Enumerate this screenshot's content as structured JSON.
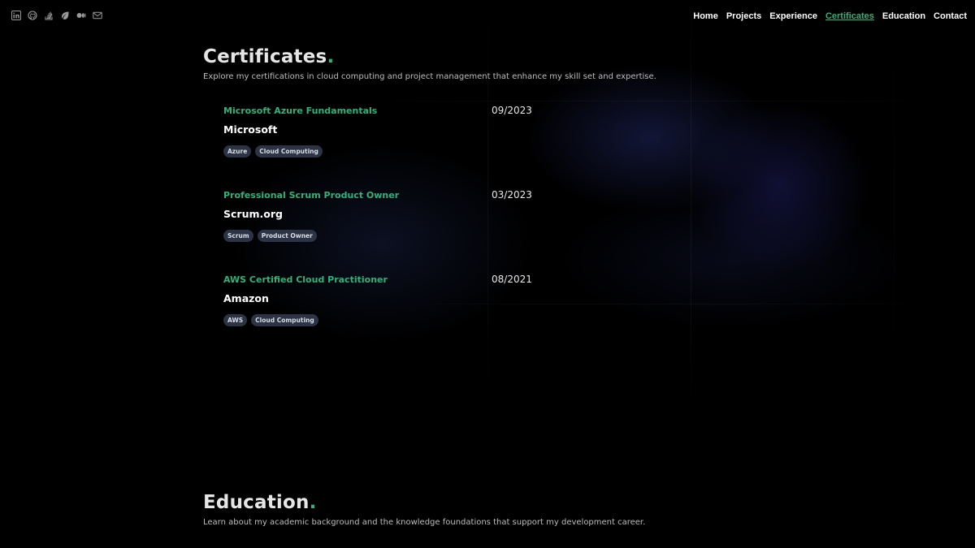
{
  "social_icons": [
    "linkedin-icon",
    "github-icon",
    "stack-overflow-icon",
    "leaf-icon",
    "medium-icon",
    "mail-icon"
  ],
  "nav": {
    "items": [
      "Home",
      "Projects",
      "Experience",
      "Certificates",
      "Education",
      "Contact"
    ],
    "active": "Certificates"
  },
  "certificates_section": {
    "title": "Certificates",
    "dot": ".",
    "subtitle": "Explore my certifications in cloud computing and project management that enhance my skill set and expertise.",
    "items": [
      {
        "name": "Microsoft Azure Fundamentals",
        "issuer": "Microsoft",
        "date": "09/2023",
        "tags": [
          "Azure",
          "Cloud Computing"
        ]
      },
      {
        "name": "Professional Scrum Product Owner",
        "issuer": "Scrum.org",
        "date": "03/2023",
        "tags": [
          "Scrum",
          "Product Owner"
        ]
      },
      {
        "name": "AWS Certified Cloud Practitioner",
        "issuer": "Amazon",
        "date": "08/2021",
        "tags": [
          "AWS",
          "Cloud Computing"
        ]
      }
    ]
  },
  "education_section": {
    "title": "Education",
    "dot": ".",
    "subtitle": "Learn about my academic background and the knowledge foundations that support my development career."
  },
  "colors": {
    "accent": "#2fb37a",
    "background": "#000000",
    "tag_bg": "#2c3344"
  }
}
